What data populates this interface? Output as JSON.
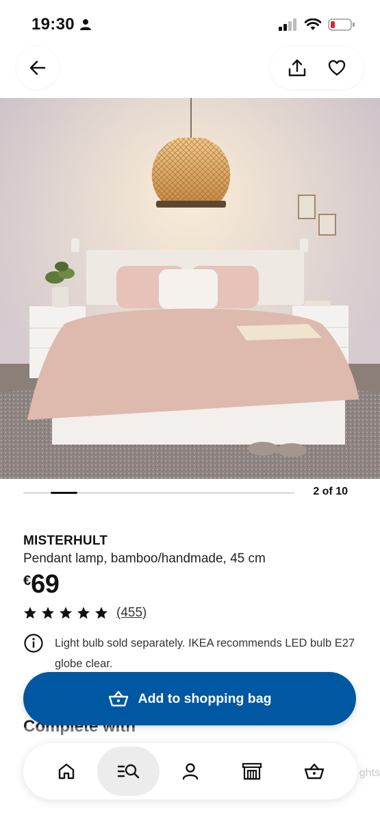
{
  "status_bar": {
    "time": "19:30",
    "icons": [
      "person-icon",
      "signal-icon",
      "wifi-icon",
      "battery-icon"
    ]
  },
  "nav": {
    "back_icon": "arrow-left-icon",
    "share_icon": "share-icon",
    "favorite_icon": "heart-icon"
  },
  "gallery": {
    "counter": "2 of 10",
    "current": 2,
    "total": 10
  },
  "product": {
    "name": "MISTERHULT",
    "description": "Pendant lamp, bamboo/handmade, 45 cm",
    "currency": "€",
    "price": "69",
    "rating_stars": 5,
    "review_count": "(455)",
    "notice": "Light bulb sold separately. IKEA recommends LED bulb E27 globe clear."
  },
  "add_to_bag": {
    "label": "Add to shopping bag",
    "icon": "basket-icon"
  },
  "section": {
    "complete_with": "Complete with"
  },
  "bottom_nav": {
    "items": [
      {
        "icon": "home-icon",
        "active": false
      },
      {
        "icon": "search-list-icon",
        "active": true
      },
      {
        "icon": "profile-icon",
        "active": false
      },
      {
        "icon": "store-icon",
        "active": false
      },
      {
        "icon": "basket-icon",
        "active": false
      }
    ],
    "ghost_right_text": "ghts"
  },
  "colors": {
    "primary": "#0058a3",
    "text": "#111111",
    "muted_track": "#dfdfdf"
  }
}
